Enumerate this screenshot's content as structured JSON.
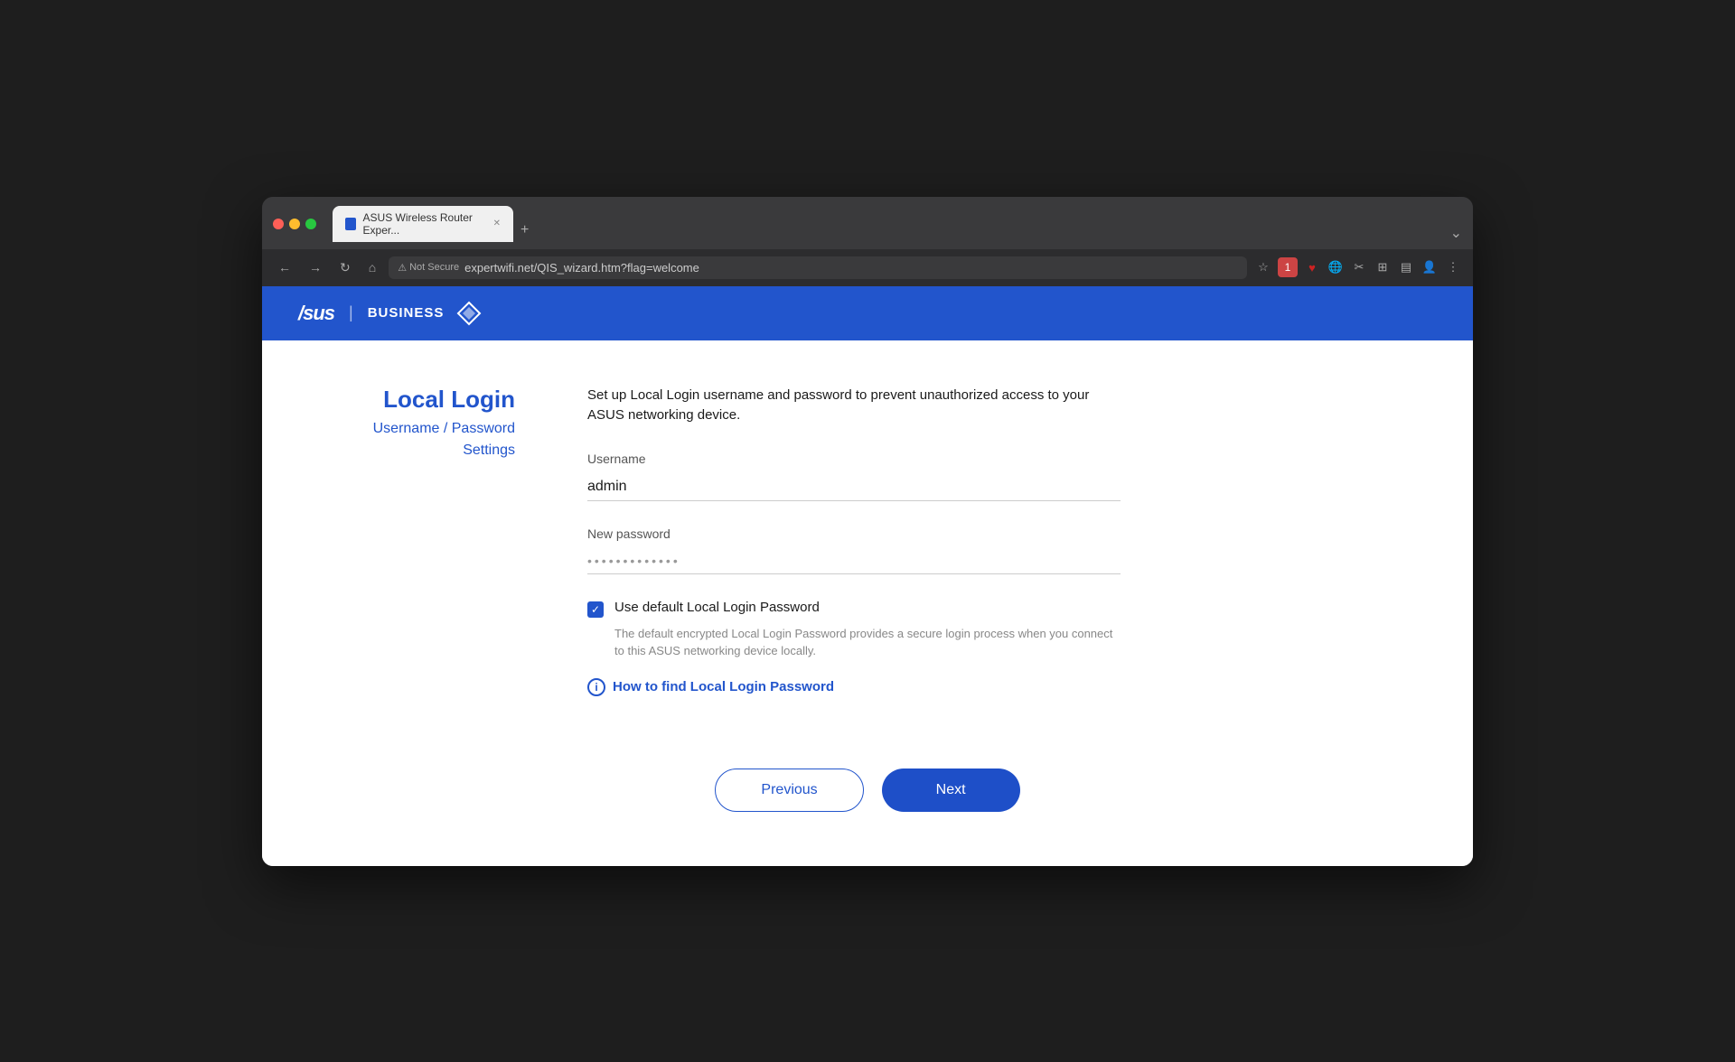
{
  "browser": {
    "tab_title": "ASUS Wireless Router Exper...",
    "url": "expertwifi.net/QIS_wizard.htm?flag=welcome",
    "not_secure_label": "Not Secure",
    "new_tab_label": "+"
  },
  "header": {
    "logo_asus": "/sus",
    "logo_divider": "|",
    "logo_business": "BUSINESS"
  },
  "sidebar": {
    "title": "Local Login",
    "subtitle": "Username / Password",
    "settings": "Settings"
  },
  "form": {
    "description": "Set up Local Login username and password to prevent unauthorized access to your ASUS networking device.",
    "username_label": "Username",
    "username_value": "admin",
    "password_label": "New password",
    "password_value": "••••••••••••••",
    "checkbox_label": "Use default Local Login Password",
    "checkbox_description": "The default encrypted Local Login Password provides a secure login process when you connect to this ASUS networking device locally.",
    "info_link": "How to find Local Login Password"
  },
  "buttons": {
    "previous": "Previous",
    "next": "Next"
  }
}
